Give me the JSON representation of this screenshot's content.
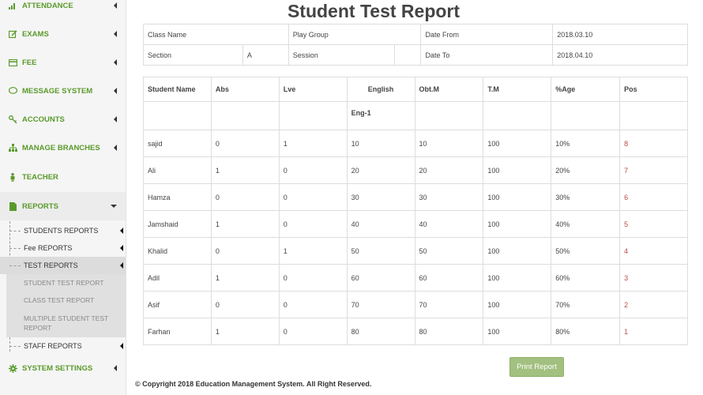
{
  "sidebar": {
    "items": [
      {
        "label": "ATTENDANCE",
        "icon": "bar-chart-icon"
      },
      {
        "label": "EXAMS",
        "icon": "edit-icon"
      },
      {
        "label": "FEE",
        "icon": "credit-card-icon"
      },
      {
        "label": "MESSAGE SYSTEM",
        "icon": "chat-icon"
      },
      {
        "label": "ACCOUNTS",
        "icon": "key-icon"
      },
      {
        "label": "MANAGE BRANCHES",
        "icon": "sitemap-icon"
      },
      {
        "label": "TEACHER",
        "icon": "person-icon"
      },
      {
        "label": "REPORTS",
        "icon": "file-icon"
      },
      {
        "label": "SYSTEM SETTINGS",
        "icon": "gear-icon"
      }
    ],
    "report_subs": [
      "STUDENTS REPORTS",
      "Fee REPORTS",
      "TEST REPORTS",
      "STAFF REPORTS"
    ],
    "test_subs": [
      "STUDENT TEST REPORT",
      "CLASS TEST REPORT",
      "MULTIPLE STUDENT TEST REPORT"
    ],
    "colors": {
      "accent": "#5a9a2b"
    }
  },
  "page": {
    "title": "Student Test Report",
    "info": {
      "class_name_label": "Class Name",
      "class_name_value": "Play Group",
      "date_from_label": "Date From",
      "date_from_value": "2018.03.10",
      "section_label": "Section",
      "section_value": "A",
      "session_label": "Session",
      "session_value": "",
      "date_to_label": "Date To",
      "date_to_value": "2018.04.10"
    },
    "table": {
      "headers": [
        "Student Name",
        "Abs",
        "Lve",
        "English",
        "Obt.M",
        "T.M",
        "%Age",
        "Pos"
      ],
      "subheader": "Eng-1",
      "rows": [
        [
          "sajid",
          "0",
          "1",
          "10",
          "10",
          "100",
          "10%",
          "8"
        ],
        [
          "Ali",
          "1",
          "0",
          "20",
          "20",
          "100",
          "20%",
          "7"
        ],
        [
          "Hamza",
          "0",
          "0",
          "30",
          "30",
          "100",
          "30%",
          "6"
        ],
        [
          "Jamshaid",
          "1",
          "0",
          "40",
          "40",
          "100",
          "40%",
          "5"
        ],
        [
          "Khalid",
          "0",
          "1",
          "50",
          "50",
          "100",
          "50%",
          "4"
        ],
        [
          "Adil",
          "1",
          "0",
          "60",
          "60",
          "100",
          "60%",
          "3"
        ],
        [
          "Asif",
          "0",
          "0",
          "70",
          "70",
          "100",
          "70%",
          "2"
        ],
        [
          "Farhan",
          "1",
          "0",
          "80",
          "80",
          "100",
          "80%",
          "1"
        ]
      ]
    },
    "print_label": "Print  Report",
    "footer": "© Copyright 2018 Education Management System. All Right Reserved.",
    "colors": {
      "button": "#a2c07f",
      "position": "#b94a48"
    }
  }
}
